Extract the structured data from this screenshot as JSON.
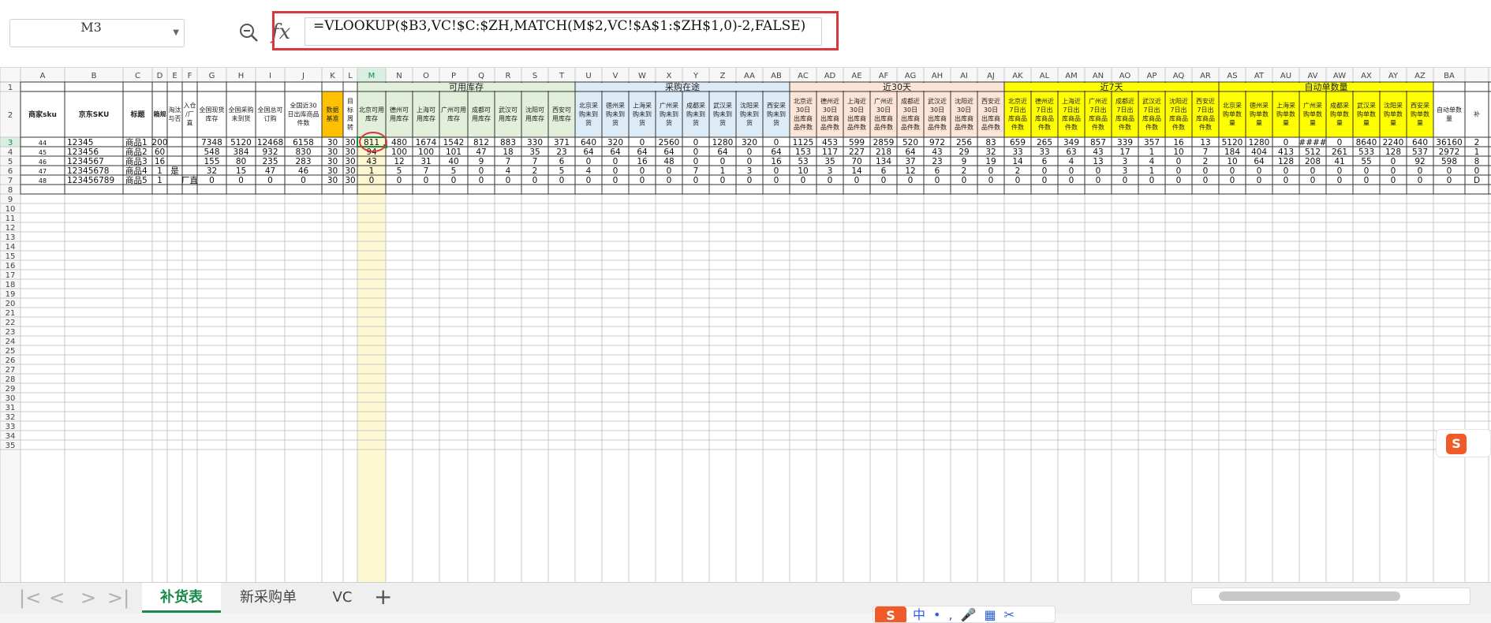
{
  "formula_bar": {
    "name_box": "M3",
    "formula": "=VLOOKUP($B3,VC!$C:$ZH,MATCH(M$2,VC!$A$1:$ZH$1,0)-2,FALSE)",
    "fx_label": "fx"
  },
  "grid": {
    "columns": [
      "A",
      "B",
      "C",
      "D",
      "E",
      "F",
      "G",
      "H",
      "I",
      "J",
      "K",
      "L",
      "M",
      "N",
      "O",
      "P",
      "Q",
      "R",
      "S",
      "T",
      "U",
      "V",
      "W",
      "X",
      "Y",
      "Z",
      "AA",
      "AB",
      "AC",
      "AD",
      "AE",
      "AF",
      "AG",
      "AH",
      "AI",
      "AJ",
      "AK",
      "AL",
      "AM",
      "AN",
      "AO",
      "AP",
      "AQ",
      "AR",
      "AS",
      "AT",
      "AU",
      "AV",
      "AW",
      "AX",
      "AY",
      "AZ",
      "BA",
      ""
    ],
    "group_headers": [
      {
        "label": "可用库存",
        "from": 12,
        "to": 19,
        "color": "#e2efda"
      },
      {
        "label": "采购在途",
        "from": 20,
        "to": 27,
        "color": "#ddebf7"
      },
      {
        "label": "近30天",
        "from": 28,
        "to": 35,
        "color": "#fce4d6"
      },
      {
        "label": "近7天",
        "from": 36,
        "to": 43,
        "color": "#ffff00"
      },
      {
        "label": "自动单数量",
        "from": 44,
        "to": 51,
        "color": "#ffff00"
      }
    ],
    "headers": [
      "商家sku",
      "京东SKU",
      "标题",
      "箱规",
      "淘汰与否",
      "入仓/厂直",
      "全国现货库存",
      "全国采购未到货",
      "全国总可订购",
      "全国近30日出库商品件数",
      "数据基准",
      "目标周转",
      "北京可用库存",
      "德州可用库存",
      "上海可用库存",
      "广州可用库存",
      "成都可用库存",
      "武汉可用库存",
      "沈阳可用库存",
      "西安可用库存",
      "北京采购未到货",
      "德州采购未到货",
      "上海采购未到货",
      "广州采购未到货",
      "成都采购未到货",
      "武汉采购未到货",
      "沈阳采购未到货",
      "西安采购未到货",
      "北京近30日出库商品件数",
      "德州近30日出库商品件数",
      "上海近30日出库商品件数",
      "广州近30日出库商品件数",
      "成都近30日出库商品件数",
      "武汉近30日出库商品件数",
      "沈阳近30日出库商品件数",
      "西安近30日出库商品件数",
      "北京近7日出库商品件数",
      "德州近7日出库商品件数",
      "上海近7日出库商品件数",
      "广州近7日出库商品件数",
      "成都近7日出库商品件数",
      "武汉近7日出库商品件数",
      "沈阳近7日出库商品件数",
      "西安近7日出库商品件数",
      "北京采购单数量",
      "德州采购单数量",
      "上海采购单数量",
      "广州采购单数量",
      "成都采购单数量",
      "武汉采购单数量",
      "沈阳采购单数量",
      "西安采购单数量",
      "自动单数量",
      "补"
    ],
    "row_numbers": [
      "1",
      "2",
      "3",
      "4",
      "5",
      "6",
      "7",
      "8",
      "9",
      "10",
      "11",
      "12",
      "13",
      "14",
      "15",
      "16",
      "17",
      "18",
      "19",
      "20",
      "21",
      "22",
      "23",
      "24",
      "25",
      "26",
      "27",
      "28",
      "29",
      "30",
      "31",
      "32",
      "33",
      "34",
      "35"
    ],
    "rows": [
      [
        "44",
        "12345",
        "商品1",
        "200",
        "",
        "",
        "7348",
        "5120",
        "12468",
        "6158",
        "30",
        "30",
        "811",
        "480",
        "1674",
        "1542",
        "812",
        "883",
        "330",
        "371",
        "640",
        "320",
        "0",
        "2560",
        "0",
        "1280",
        "320",
        "0",
        "1125",
        "453",
        "599",
        "2859",
        "520",
        "972",
        "256",
        "83",
        "659",
        "265",
        "349",
        "857",
        "339",
        "357",
        "16",
        "13",
        "5120",
        "1280",
        "0",
        "####",
        "0",
        "8640",
        "2240",
        "640",
        "36160",
        "2"
      ],
      [
        "45",
        "123456",
        "商品2",
        "60",
        "",
        "",
        "548",
        "384",
        "932",
        "830",
        "30",
        "30",
        "94",
        "100",
        "100",
        "101",
        "47",
        "18",
        "35",
        "23",
        "64",
        "64",
        "64",
        "64",
        "0",
        "64",
        "0",
        "64",
        "153",
        "117",
        "227",
        "218",
        "64",
        "43",
        "29",
        "32",
        "33",
        "33",
        "63",
        "43",
        "17",
        "1",
        "10",
        "7",
        "184",
        "404",
        "413",
        "512",
        "261",
        "533",
        "128",
        "537",
        "2972",
        "1"
      ],
      [
        "46",
        "1234567",
        "商品3",
        "16",
        "",
        "",
        "155",
        "80",
        "235",
        "283",
        "30",
        "30",
        "43",
        "12",
        "31",
        "40",
        "9",
        "7",
        "7",
        "6",
        "0",
        "0",
        "16",
        "48",
        "0",
        "0",
        "0",
        "16",
        "53",
        "35",
        "70",
        "134",
        "37",
        "23",
        "9",
        "19",
        "14",
        "6",
        "4",
        "13",
        "3",
        "4",
        "0",
        "2",
        "10",
        "64",
        "128",
        "208",
        "41",
        "55",
        "0",
        "92",
        "598",
        "8"
      ],
      [
        "47",
        "12345678",
        "商品4",
        "1",
        "是",
        "",
        "32",
        "15",
        "47",
        "46",
        "30",
        "30",
        "1",
        "5",
        "7",
        "5",
        "0",
        "4",
        "2",
        "5",
        "4",
        "0",
        "0",
        "0",
        "7",
        "1",
        "3",
        "0",
        "10",
        "3",
        "14",
        "6",
        "12",
        "6",
        "2",
        "0",
        "2",
        "0",
        "0",
        "0",
        "3",
        "1",
        "0",
        "0",
        "0",
        "0",
        "0",
        "0",
        "0",
        "0",
        "0",
        "0",
        "0",
        "0"
      ],
      [
        "48",
        "123456789",
        "商品5",
        "1",
        "",
        "厂直",
        "0",
        "0",
        "0",
        "0",
        "30",
        "30",
        "0",
        "0",
        "0",
        "0",
        "0",
        "0",
        "0",
        "0",
        "0",
        "0",
        "0",
        "0",
        "0",
        "0",
        "0",
        "0",
        "0",
        "0",
        "0",
        "0",
        "0",
        "0",
        "0",
        "0",
        "0",
        "0",
        "0",
        "0",
        "0",
        "0",
        "0",
        "0",
        "0",
        "0",
        "0",
        "0",
        "0",
        "0",
        "0",
        "0",
        "0",
        "D"
      ]
    ],
    "selected_cell": {
      "col": 12,
      "row": 3
    }
  },
  "sheet_tabs": {
    "tabs": [
      "补货表",
      "新采购单",
      "VC"
    ],
    "active": "补货表",
    "add_label": "+"
  },
  "status_bar": {
    "ime_logo": "S",
    "ime_text": "中•,🎤▦✂"
  },
  "sogou_logo": "S",
  "colors": {
    "grid_line": "#c9c9c9",
    "selected_col": "#fdf8d2",
    "header_orange": "#ffc000",
    "highlight_red": "#d9363e",
    "accent_green": "#1a8a4a"
  }
}
